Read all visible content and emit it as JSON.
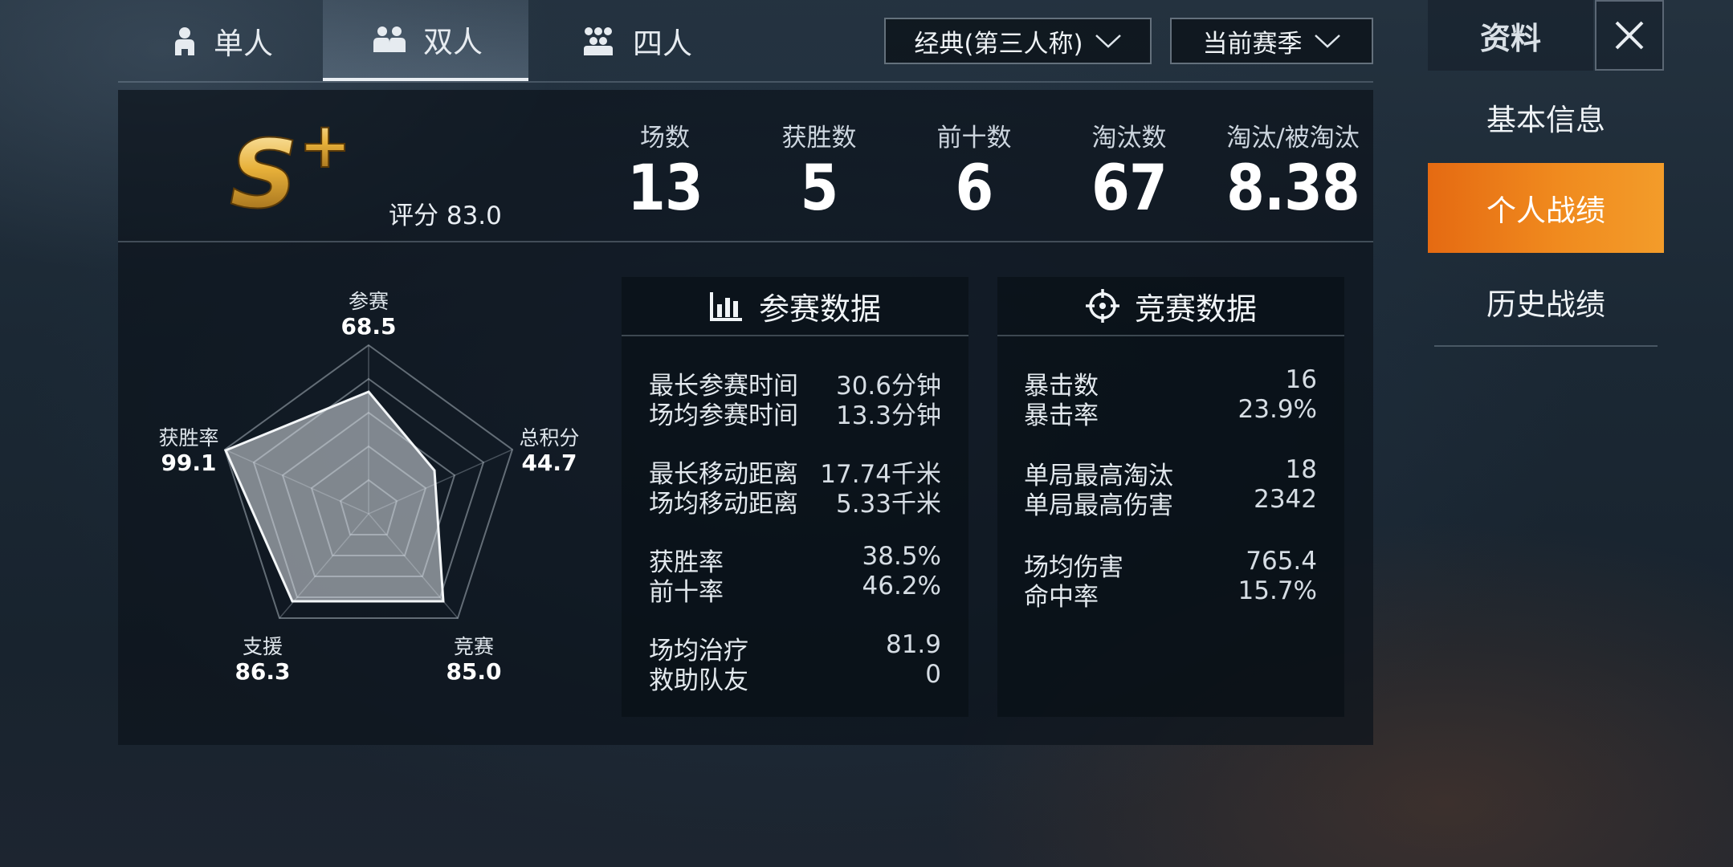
{
  "tabs": [
    {
      "label": "单人",
      "icon": "single-person-icon"
    },
    {
      "label": "双人",
      "icon": "duo-icon",
      "active": true
    },
    {
      "label": "四人",
      "icon": "squad-icon"
    }
  ],
  "filters": {
    "mode": "经典(第三人称)",
    "season": "当前赛季"
  },
  "rank": {
    "tier": "S+",
    "score_label": "评分 83.0"
  },
  "summary": [
    {
      "label": "场数",
      "value": "13"
    },
    {
      "label": "获胜数",
      "value": "5"
    },
    {
      "label": "前十数",
      "value": "6"
    },
    {
      "label": "淘汰数",
      "value": "67"
    },
    {
      "label": "淘汰/被淘汰",
      "value": "8.38"
    }
  ],
  "radar": {
    "axes": [
      {
        "name": "参赛",
        "value": "68.5"
      },
      {
        "name": "总积分",
        "value": "44.7"
      },
      {
        "name": "竞赛",
        "value": "85.0"
      },
      {
        "name": "支援",
        "value": "86.3"
      },
      {
        "name": "获胜率",
        "value": "99.1"
      }
    ]
  },
  "participation": {
    "title": "参赛数据",
    "rows": [
      {
        "label": "最长参赛时间",
        "value": "30.6分钟"
      },
      {
        "label": "场均参赛时间",
        "value": "13.3分钟"
      },
      {
        "label": "最长移动距离",
        "value": "17.74千米"
      },
      {
        "label": "场均移动距离",
        "value": "5.33千米"
      },
      {
        "label": "获胜率",
        "value": "38.5%"
      },
      {
        "label": "前十率",
        "value": "46.2%"
      },
      {
        "label": "场均治疗",
        "value": "81.9"
      },
      {
        "label": "救助队友",
        "value": "0"
      }
    ]
  },
  "combat": {
    "title": "竞赛数据",
    "rows": [
      {
        "label": "暴击数",
        "value": "16"
      },
      {
        "label": "暴击率",
        "value": "23.9%"
      },
      {
        "label": "单局最高淘汰",
        "value": "18"
      },
      {
        "label": "单局最高伤害",
        "value": "2342"
      },
      {
        "label": "场均伤害",
        "value": "765.4"
      },
      {
        "label": "命中率",
        "value": "15.7%"
      }
    ]
  },
  "sidebar": {
    "title": "资料",
    "items": [
      {
        "label": "基本信息"
      },
      {
        "label": "个人战绩",
        "active": true
      },
      {
        "label": "历史战绩"
      }
    ]
  },
  "colors": {
    "accent_orange": "#f08a1e",
    "rank_gold": "#e8b13a"
  }
}
